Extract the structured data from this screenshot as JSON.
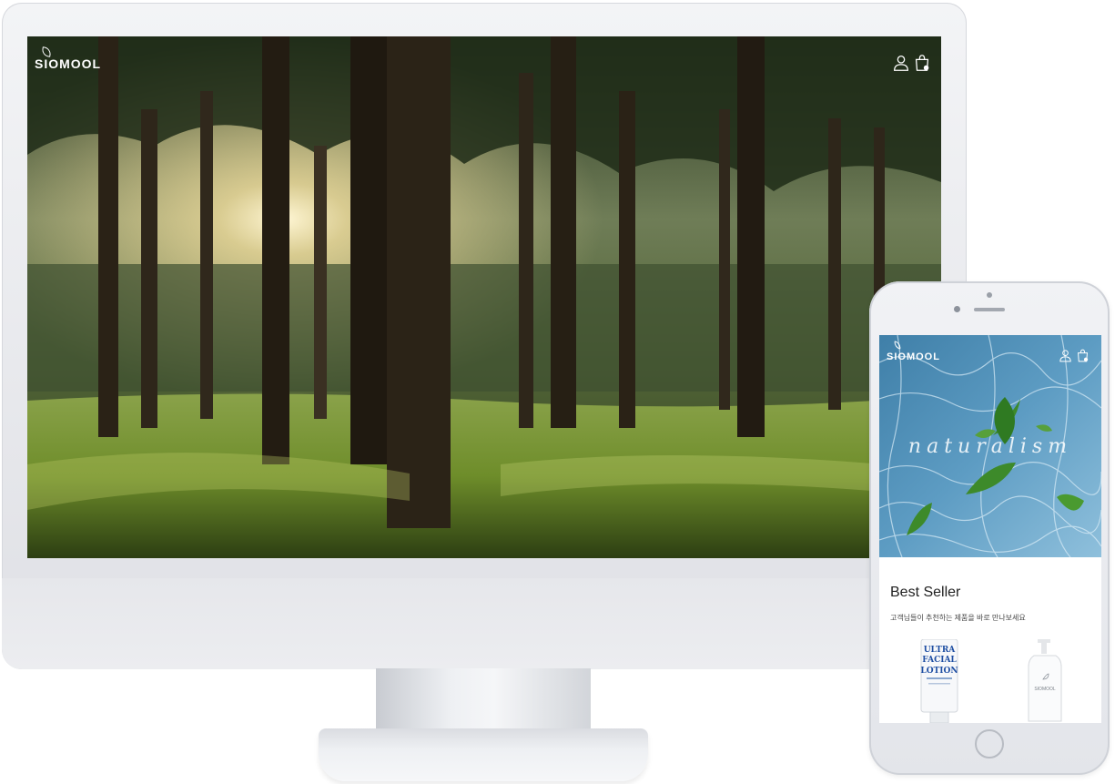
{
  "brand": {
    "name": "SIOMOOL"
  },
  "desktop": {
    "header": {
      "logo_text": "SIOMOOL",
      "icons": [
        "user-icon",
        "shopping-bag-icon"
      ]
    },
    "hero": {
      "scene": "forest"
    }
  },
  "mobile": {
    "header": {
      "logo_text": "SIOMOOL",
      "icons": [
        "user-icon",
        "shopping-bag-icon"
      ]
    },
    "hero": {
      "tagline": "naturalism"
    },
    "best_seller": {
      "title": "Best Seller",
      "subtitle": "고객님들이 추천하는 제품을 바로 만나보세요",
      "products": [
        {
          "label_lines": [
            "ULTRA",
            "FACIAL",
            "LOTION"
          ]
        },
        {
          "label": "SIOMOOL"
        }
      ]
    }
  },
  "colors": {
    "accent_blue": "#1f4fa3",
    "leaf_green": "#3d8a2a",
    "water_blue": "#4f8fb6"
  }
}
